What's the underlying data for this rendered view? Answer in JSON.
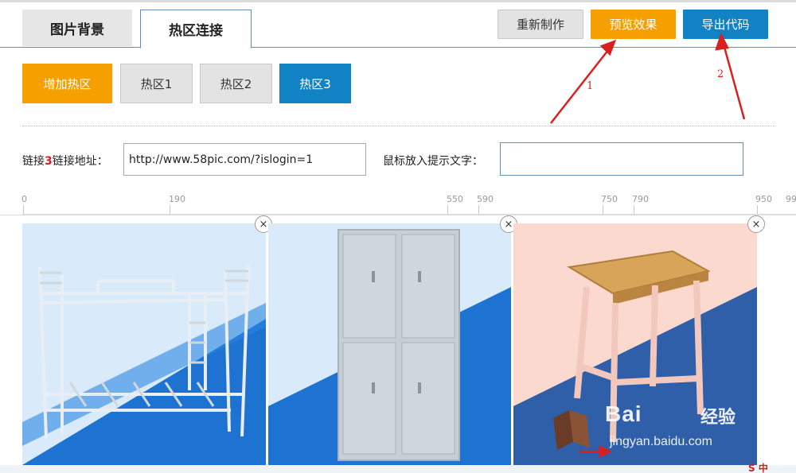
{
  "tabs": [
    {
      "label": "图片背景"
    },
    {
      "label": "热区连接"
    }
  ],
  "toolbar": {
    "redo_label": "重新制作",
    "preview_label": "预览效果",
    "export_label": "导出代码"
  },
  "hotspots": {
    "add_label": "增加热区",
    "items": [
      {
        "label": "热区1"
      },
      {
        "label": "热区2"
      },
      {
        "label": "热区3"
      }
    ]
  },
  "form": {
    "link_label_prefix": "链接",
    "link_number": "3",
    "link_label_suffix": "链接地址：",
    "link_value": "http://www.58pic.com/?islogin=1",
    "tip_label": "鼠标放入提示文字：",
    "tip_value": ""
  },
  "ruler": {
    "ticks": [
      "0",
      "190",
      "550",
      "590",
      "750",
      "790",
      "950",
      "99"
    ]
  },
  "annotations": {
    "arrow1_number": "1",
    "arrow2_number": "2"
  },
  "watermark": {
    "brand": "Bai",
    "brand_cn": "经验",
    "site": "jingyan.baidu.com"
  },
  "close_symbol": "×",
  "ime_label": "S 中",
  "colors": {
    "accent_orange": "#f6a000",
    "accent_blue": "#1182c4",
    "button_gray": "#e3e3e3",
    "annotation_red": "#d82020"
  }
}
